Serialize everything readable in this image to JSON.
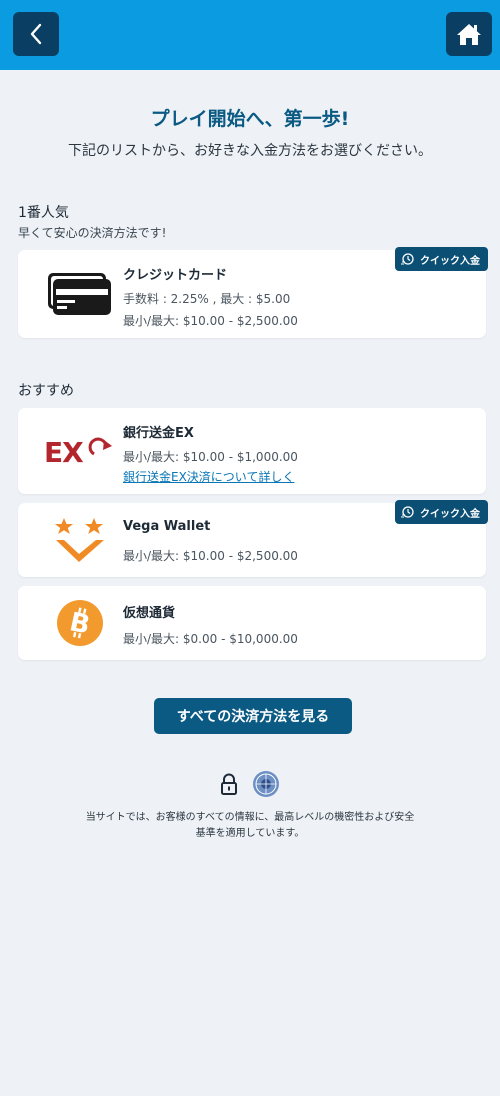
{
  "header": {
    "back_icon": "chevron-left-icon",
    "home_icon": "home-icon",
    "bar_color": "#0a9be0",
    "button_color": "#0a3f63"
  },
  "hero": {
    "title": "プレイ開始へ、第一歩!",
    "subtitle": "下記のリストから、お好きな入金方法をお選びください。"
  },
  "popular": {
    "title": "1番人気",
    "subtitle": "早くて安心の決済方法です!"
  },
  "recommended": {
    "title": "おすすめ"
  },
  "methods": {
    "credit": {
      "name": "クレジットカード",
      "fee": "手数料 : 2.25% , 最大 : $5.00",
      "limits": "最小/最大: $10.00 - $2,500.00",
      "badge": "クイック入金"
    },
    "bank": {
      "name": "銀行送金EX",
      "limits": "最小/最大: $10.00 - $1,000.00",
      "link": "銀行送金EX決済について詳しく"
    },
    "vega": {
      "name": "Vega Wallet",
      "limits": "最小/最大: $10.00 - $2,500.00",
      "badge": "クイック入金"
    },
    "crypto": {
      "name": "仮想通貨",
      "limits": "最小/最大: $0.00 - $10,000.00"
    }
  },
  "all_methods_button": "すべての決済方法を見る",
  "footer": {
    "line1": "当サイトでは、お客様のすべての情報に、最高レベルの機密性および安全",
    "line2": "基準を適用しています。"
  }
}
